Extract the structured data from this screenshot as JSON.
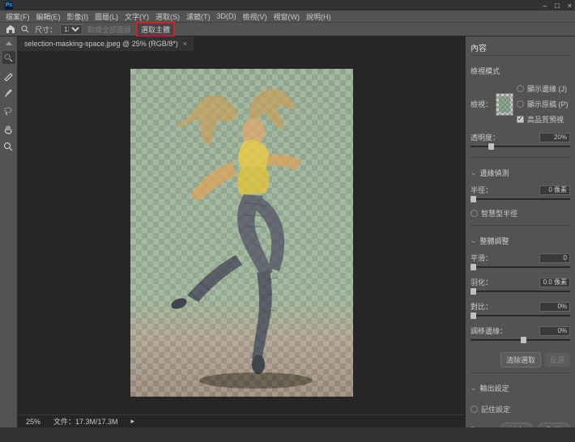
{
  "titlebar": {
    "logo": "Ps",
    "min": "–",
    "max": "□",
    "close": "×"
  },
  "menu": [
    "檔案(F)",
    "編輯(E)",
    "影像(I)",
    "圖層(L)",
    "文字(Y)",
    "選取(S)",
    "濾鏡(T)",
    "3D(D)",
    "檢視(V)",
    "視窗(W)",
    "說明(H)"
  ],
  "optbar": {
    "size_label": "尺寸：",
    "size_value": "13",
    "button_gray": "取樣全部圖層",
    "button_hl": "選取主體"
  },
  "tab": {
    "title": "selection-masking-space.jpeg @ 25% (RGB/8*)",
    "close": "×"
  },
  "status": {
    "zoom": "25%",
    "info": "文件：17.3M/17.3M"
  },
  "panel": {
    "title": "內容",
    "view_mode_label": "檢視模式",
    "view_label": "檢視：",
    "opt_overlay": "顯示邊緣 (J)",
    "opt_original": "顯示原稿 (P)",
    "opt_hq": "高品質預視",
    "opacity_label": "透明度：",
    "opacity_val": "20%",
    "edge_section": "邊緣偵測",
    "radius_label": "半徑：",
    "radius_val": "0 像素",
    "smart_radius": "智慧型半徑",
    "refine_section": "整體調整",
    "smooth_label": "平滑：",
    "smooth_val": "0",
    "feather_label": "羽化：",
    "feather_val": "0.0 像素",
    "contrast_label": "對比：",
    "contrast_val": "0%",
    "shift_label": "調移邊緣：",
    "shift_val": "0%",
    "clear_btn": "清除選取",
    "invert_btn": "反選",
    "output_section": "輸出設定",
    "remember": "記住設定",
    "ok": "確定",
    "cancel": "取消"
  }
}
